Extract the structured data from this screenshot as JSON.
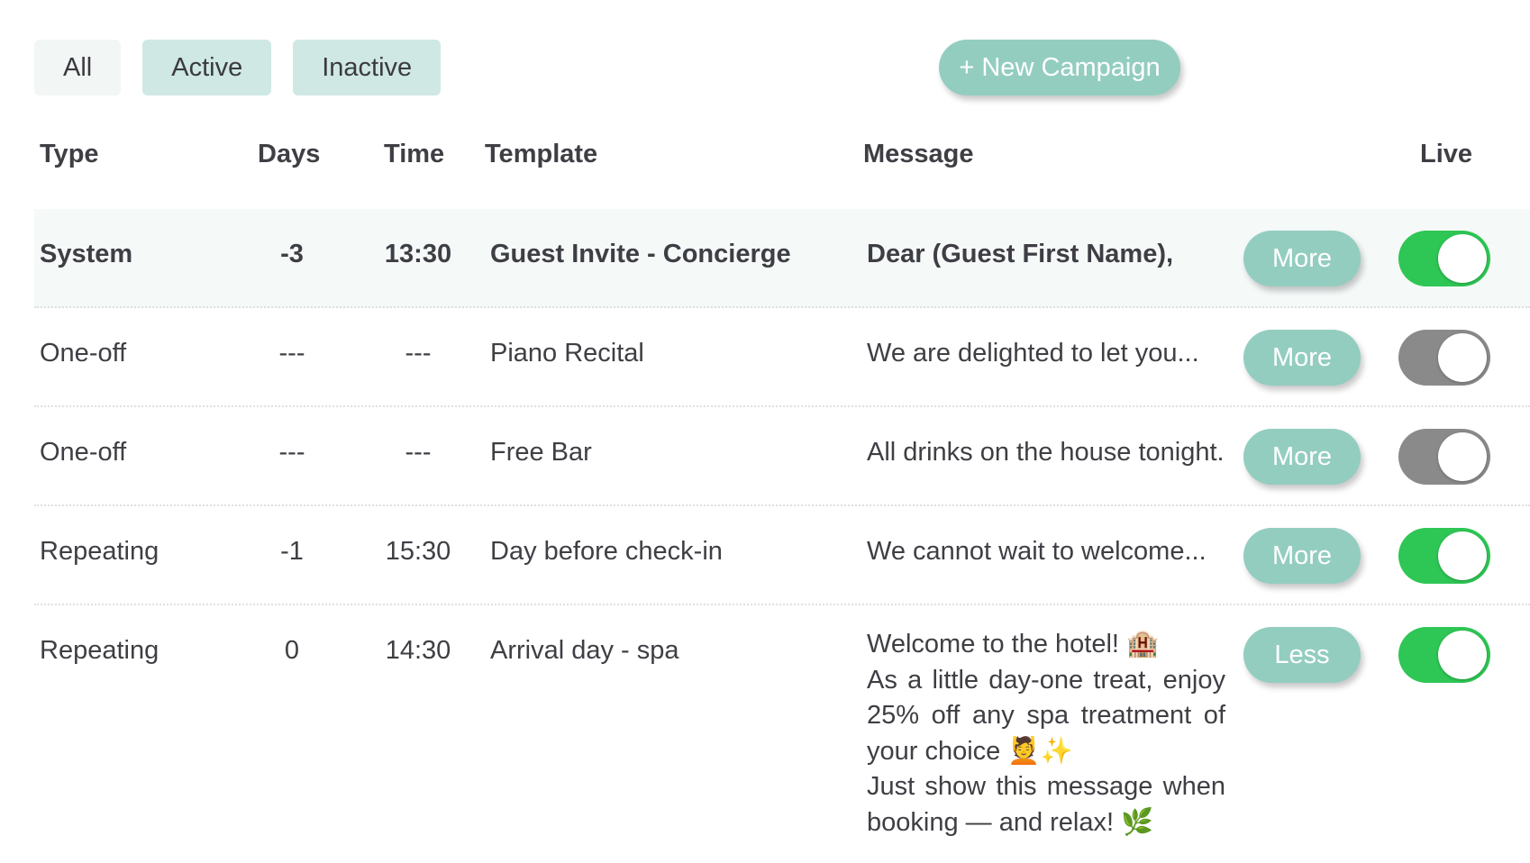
{
  "filters": {
    "all": "All",
    "active": "Active",
    "inactive": "Inactive"
  },
  "new_campaign_label": "+ New Campaign",
  "columns": {
    "type": "Type",
    "days": "Days",
    "time": "Time",
    "template": "Template",
    "message": "Message",
    "live": "Live"
  },
  "rows": [
    {
      "type": "System",
      "days": "-3",
      "time": "13:30",
      "template": "Guest Invite - Concierge",
      "message": "Dear (Guest First Name),",
      "toggle_label": "More",
      "live": true
    },
    {
      "type": "One-off",
      "days": "---",
      "time": "---",
      "template": "Piano Recital",
      "message": "We are delighted to let you...",
      "toggle_label": "More",
      "live": false
    },
    {
      "type": "One-off",
      "days": "---",
      "time": "---",
      "template": "Free Bar",
      "message": "All drinks on the  house tonight.",
      "toggle_label": "More",
      "live": false
    },
    {
      "type": "Repeating",
      "days": "-1",
      "time": "15:30",
      "template": "Day before check-in",
      "message": "We cannot wait to welcome...",
      "toggle_label": "More",
      "live": true
    },
    {
      "type": "Repeating",
      "days": "0",
      "time": "14:30",
      "template": "Arrival day - spa",
      "message_lines": [
        "Welcome to the hotel! 🏨",
        "As a little day-one treat, enjoy 25% off any spa treatment of your choice 💆✨",
        "Just show this message when booking — and relax! 🌿"
      ],
      "toggle_label": "Less",
      "live": true
    }
  ],
  "colors": {
    "accent": "#93cdc0",
    "filter_active_bg": "#cfe8e3",
    "toggle_on": "#2ec654",
    "toggle_off": "#8a8a8a"
  }
}
